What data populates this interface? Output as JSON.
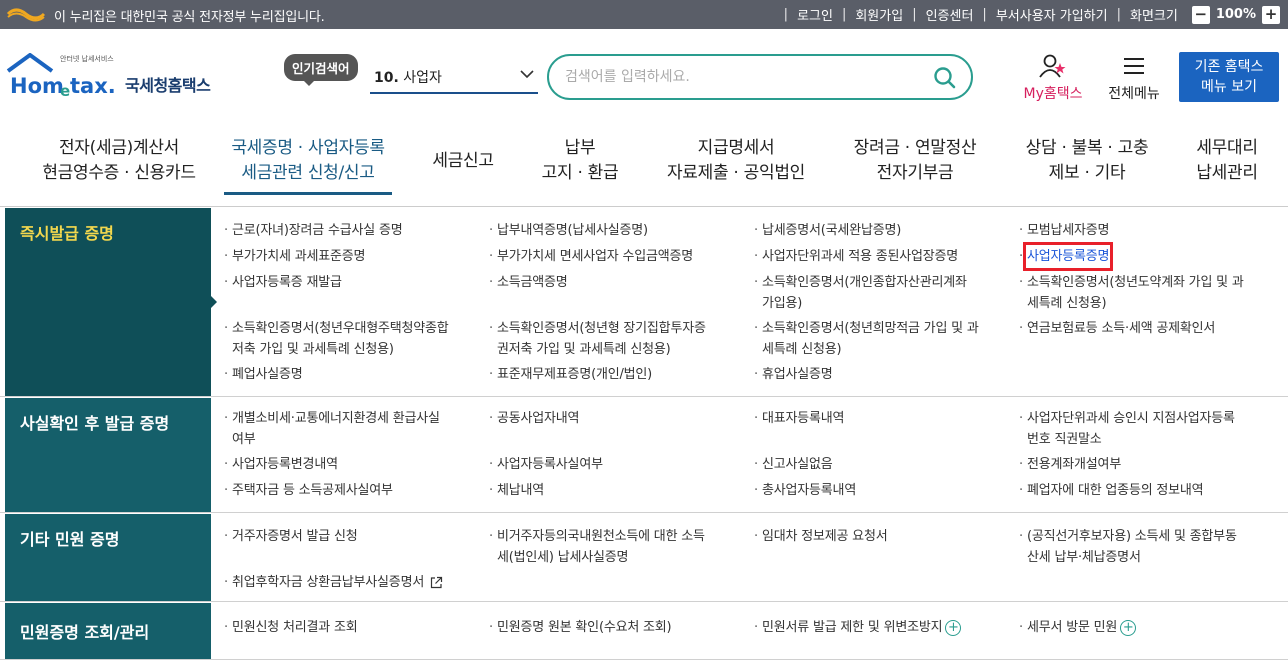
{
  "topbar": {
    "notice": "이 누리집은 대한민국 공식 전자정부 누리집입니다.",
    "login": "로그인",
    "signup": "회원가입",
    "cert": "인증센터",
    "dept_signup": "부서사용자 가입하기",
    "screen_size": "화면크기",
    "zoom": "100%",
    "zoom_out": "−",
    "zoom_in": "+"
  },
  "header": {
    "brand_top": "안터넷 납세서비스",
    "brand_name": "Hometax.",
    "brand_kor": "국세청홈택스",
    "popular_badge": "인기검색어",
    "popular_rank": "10.",
    "popular_term": "사업자",
    "search_placeholder": "검색어를 입력하세요.",
    "myhome": "My홈택스",
    "allmenu": "전체메뉴",
    "old_menu_line1": "기존 홈택스",
    "old_menu_line2": "메뉴 보기",
    "colors": {
      "accent": "#2a9d8f",
      "brand_blue": "#1b64c0",
      "active_nav": "#1a5b84"
    }
  },
  "gnb": [
    {
      "l1": "전자(세금)계산서",
      "l2": "현금영수증 · 신용카드"
    },
    {
      "l1": "국세증명 · 사업자등록",
      "l2": "세금관련 신청/신고"
    },
    {
      "l1": "세금신고",
      "l2": ""
    },
    {
      "l1": "납부",
      "l2": "고지 · 환급"
    },
    {
      "l1": "지급명세서",
      "l2": "자료제출 · 공익법인"
    },
    {
      "l1": "장려금 · 연말정산",
      "l2": "전자기부금"
    },
    {
      "l1": "상담 · 불복 · 고충",
      "l2": "제보 · 기타"
    },
    {
      "l1": "세무대리",
      "l2": "납세관리"
    }
  ],
  "sections": [
    {
      "title": "즉시발급 증명"
    },
    {
      "title": "사실확인 후 발급 증명"
    },
    {
      "title": "기타 민원 증명"
    },
    {
      "title": "민원증명 조회/관리"
    }
  ],
  "links": {
    "s1": [
      "근로(자녀)장려금 수급사실 증명",
      "납부내역증명(납세사실증명)",
      "납세증명서(국세완납증명)",
      "모범납세자증명",
      "부가가치세 과세표준증명",
      "부가가치세 면세사업자 수입금액증명",
      "사업자단위과세 적용 종된사업장증명",
      "사업자등록증명",
      "사업자등록증 재발급",
      "소득금액증명",
      "소득확인증명서(개인종합자산관리계좌",
      "가입용)",
      "소득확인증명서(청년도약계좌 가입 및 과",
      "세특례 신청용)",
      "소득확인증명서(청년우대형주택청약종합",
      "저축 가입 및 과세특례 신청용)",
      "소득확인증명서(청년형 장기집합투자증",
      "권저축 가입 및 과세특례 신청용)",
      "소득확인증명서(청년희망적금 가입 및 과",
      "세특례 신청용)",
      "연금보험료등 소득·세액 공제확인서",
      "폐업사실증명",
      "표준재무제표증명(개인/법인)",
      "휴업사실증명"
    ],
    "s2": [
      "개별소비세·교통에너지환경세 환급사실",
      "여부",
      "공동사업자내역",
      "대표자등록내역",
      "사업자단위과세 승인시 지점사업자등록",
      "번호 직권말소",
      "사업자등록변경내역",
      "사업자등록사실여부",
      "신고사실없음",
      "전용계좌개설여부",
      "주택자금 등 소득공제사실여부",
      "체납내역",
      "총사업자등록내역",
      "폐업자에 대한 업종등의 정보내역"
    ],
    "s3": [
      "거주자증명서 발급 신청",
      "비거주자등의국내원천소득에 대한 소득",
      "세(법인세) 납세사실증명",
      "임대차 정보제공 요청서",
      "(공직선거후보자용) 소득세 및 종합부동",
      "산세 납부·체납증명서",
      "취업후학자금 상환금납부사실증명서"
    ],
    "s4": [
      "민원신청 처리결과 조회",
      "민원증명 원본 확인(수요처 조회)",
      "민원서류 발급 제한 및 위변조방지",
      "세무서 방문 민원"
    ]
  }
}
